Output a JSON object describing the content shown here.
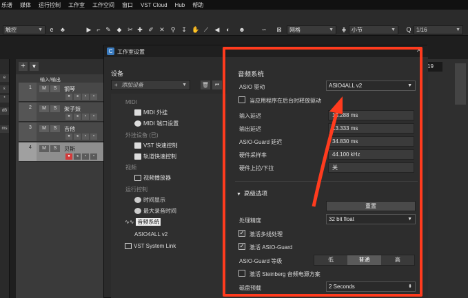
{
  "menubar": [
    "乐谱",
    "媒体",
    "运行控制",
    "工作室",
    "工作空间",
    "窗口",
    "VST Cloud",
    "Hub",
    "帮助"
  ],
  "toolbar": {
    "mode_drop": "触控",
    "grid_drop": "网格",
    "bar_drop": "小节",
    "quant_drop": "1/16",
    "quant_label": "Q"
  },
  "tracks": [
    {
      "num": "1",
      "name": "钢琴"
    },
    {
      "num": "2",
      "name": "架子鼓"
    },
    {
      "num": "3",
      "name": "吉他"
    },
    {
      "num": "4",
      "name": "贝斯"
    }
  ],
  "tracks_header": "输入/输出",
  "left_strip": [
    "e",
    "ε",
    "*",
    "dB",
    "ms"
  ],
  "right_value": "19",
  "dialog": {
    "title": "工作室设置",
    "devices_label": "设备",
    "add_device": "添加设备",
    "tree": {
      "cat_midi": "MIDI",
      "midi_in": "MIDI 外挂",
      "midi_port": "MIDI 端口设置",
      "cat_remote": "外挂设备 (已)",
      "vst_quick": "VST 快速控制",
      "track_quick": "轨道快速控制",
      "cat_video": "视频",
      "video_player": "视频播放器",
      "cat_transport": "运行控制",
      "time_display": "时间显示",
      "max_record": "最大录音时间",
      "audio_system": "音频系统",
      "asio_driver_item": "ASIO4ALL v2",
      "vst_link": "VST System Link"
    },
    "panel": {
      "title": "音频系统",
      "asio_label": "ASIO 驱动",
      "asio_value": "ASIO4ALL v2",
      "release_driver": "当应用程序在后台时释放驱动",
      "input_latency_label": "输入延迟",
      "input_latency": "13.288 ms",
      "output_latency_label": "输出延迟",
      "output_latency": "13.333 ms",
      "guard_latency_label": "ASIO-Guard 延迟",
      "guard_latency": "34.830 ms",
      "sample_rate_label": "硬件采样率",
      "sample_rate": "44.100 kHz",
      "pulldown_label": "硬件上拉/下拉",
      "pulldown": "关",
      "advanced": "高级选项",
      "reset": "重置",
      "precision_label": "处理精度",
      "precision": "32 bit float",
      "multi_proc": "激活多线处理",
      "asio_guard": "激活 ASIO-Guard",
      "guard_level_label": "ASIO-Guard 等级",
      "guard_levels": [
        "低",
        "普通",
        "高"
      ],
      "steinberg_power": "激活 Steinberg 音频电源方案",
      "disk_preload_label": "磁盘预载",
      "disk_preload": "2 Seconds"
    }
  },
  "colors": {
    "highlight_box": "#ff3b1e",
    "record": "#d23a3a"
  }
}
